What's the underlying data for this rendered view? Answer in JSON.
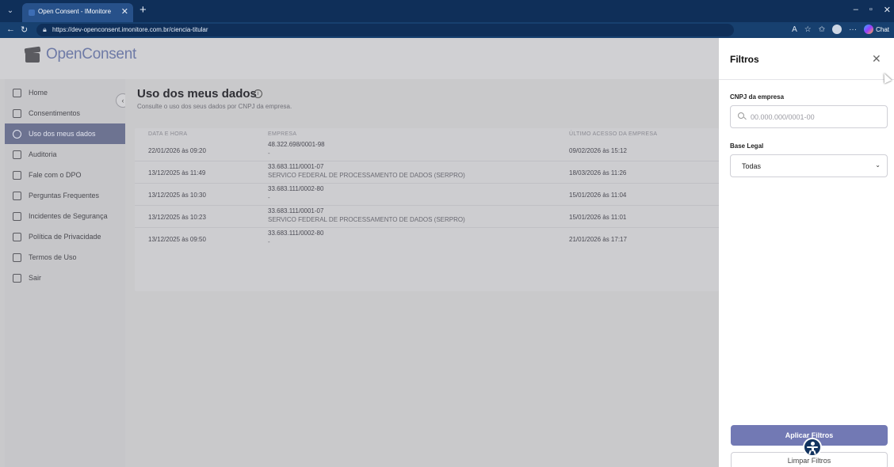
{
  "browser": {
    "tab_title": "Open Consent - IMonitore",
    "url": "https://dev-openconsent.imonitore.com.br/ciencia-titular",
    "copilot_label": "Chat"
  },
  "app": {
    "logo_text": "OpenConsent"
  },
  "sidebar": {
    "items": [
      {
        "label": "Home",
        "icon": "home-icon"
      },
      {
        "label": "Consentimentos",
        "icon": "document-icon"
      },
      {
        "label": "Uso dos meus dados",
        "icon": "eye-icon",
        "active": true
      },
      {
        "label": "Auditoria",
        "icon": "clipboard-icon"
      },
      {
        "label": "Fale com o DPO",
        "icon": "document-icon"
      },
      {
        "label": "Perguntas Frequentes",
        "icon": "chat-icon"
      },
      {
        "label": "Incidentes de Segurança",
        "icon": "warning-icon"
      },
      {
        "label": "Política de Privacidade",
        "icon": "shield-icon"
      },
      {
        "label": "Termos de Uso",
        "icon": "document-icon"
      },
      {
        "label": "Sair",
        "icon": "logout-icon"
      }
    ]
  },
  "main": {
    "title": "Uso dos meus dados",
    "subtitle": "Consulte o uso dos seus dados por CNPJ da empresa.",
    "table": {
      "headers": [
        "DATA E HORA",
        "EMPRESA",
        "ÚLTIMO ACESSO DA EMPRESA"
      ],
      "rows": [
        {
          "date": "22/01/2026 às 09:20",
          "cnpj": "48.322.698/0001-98",
          "company": "-",
          "last_access": "09/02/2026 às 15:12"
        },
        {
          "date": "13/12/2025 às 11:49",
          "cnpj": "33.683.111/0001-07",
          "company": "SERVICO FEDERAL DE PROCESSAMENTO DE DADOS (SERPRO)",
          "last_access": "18/03/2026 às 11:26"
        },
        {
          "date": "13/12/2025 às 10:30",
          "cnpj": "33.683.111/0002-80",
          "company": "-",
          "last_access": "15/01/2026 às 11:04"
        },
        {
          "date": "13/12/2025 às 10:23",
          "cnpj": "33.683.111/0001-07",
          "company": "SERVICO FEDERAL DE PROCESSAMENTO DE DADOS (SERPRO)",
          "last_access": "15/01/2026 às 11:01"
        },
        {
          "date": "13/12/2025 às 09:50",
          "cnpj": "33.683.111/0002-80",
          "company": "-",
          "last_access": "21/01/2026 às 17:17"
        }
      ]
    }
  },
  "filters": {
    "title": "Filtros",
    "cnpj_label": "CNPJ da empresa",
    "cnpj_placeholder": "00.000.000/0001-00",
    "base_label": "Base Legal",
    "base_value": "Todas",
    "apply_label": "Aplicar Filtros",
    "clear_label": "Limpar Filtros"
  },
  "colors": {
    "accent": "#7279b4",
    "browser_bar": "#0f2f59",
    "active_nav": "#6d7391"
  }
}
